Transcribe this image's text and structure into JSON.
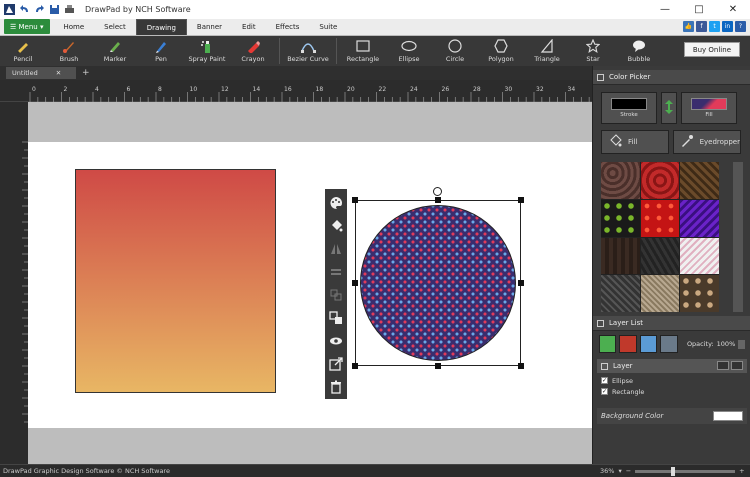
{
  "window": {
    "title": "DrawPad by NCH Software"
  },
  "ribbon": {
    "menu_label": "Menu",
    "tabs": [
      "Home",
      "Select",
      "Drawing",
      "Banner",
      "Edit",
      "Effects",
      "Suite"
    ],
    "active_tab": "Drawing"
  },
  "toolbar": {
    "tools": [
      "Pencil",
      "Brush",
      "Marker",
      "Pen",
      "Spray Paint",
      "Crayon",
      "Bezier Curve",
      "Rectangle",
      "Ellipse",
      "Circle",
      "Polygon",
      "Triangle",
      "Star",
      "Bubble"
    ],
    "buy_online": "Buy Online"
  },
  "document": {
    "tab_name": "Untitled"
  },
  "ruler": {
    "top_ticks": [
      "0",
      "2",
      "4",
      "6",
      "8",
      "10",
      "12",
      "14",
      "16",
      "18",
      "20",
      "22",
      "24",
      "26",
      "28",
      "30",
      "32",
      "34"
    ]
  },
  "canvas": {
    "rectangle_gradient": [
      "#cf4a46",
      "#e8b664"
    ],
    "circle_pattern_colors": [
      "#3a2d6e",
      "#e23b5a",
      "#6aa8e8"
    ]
  },
  "color_picker": {
    "title": "Color Picker",
    "stroke_label": "Stroke",
    "fill_label": "Fill",
    "fill_button": "Fill",
    "eyedropper_button": "Eyedropper"
  },
  "layer_list": {
    "title": "Layer List",
    "opacity_label": "Opacity:",
    "opacity_value": "100%",
    "layer_name": "Layer",
    "items": [
      "Ellipse",
      "Rectangle"
    ]
  },
  "background_color": {
    "label": "Background Color",
    "color": "#ffffff"
  },
  "status": {
    "text": "DrawPad Graphic Design Software © NCH Software",
    "zoom": "36%",
    "zoom_fraction": 0.36
  }
}
